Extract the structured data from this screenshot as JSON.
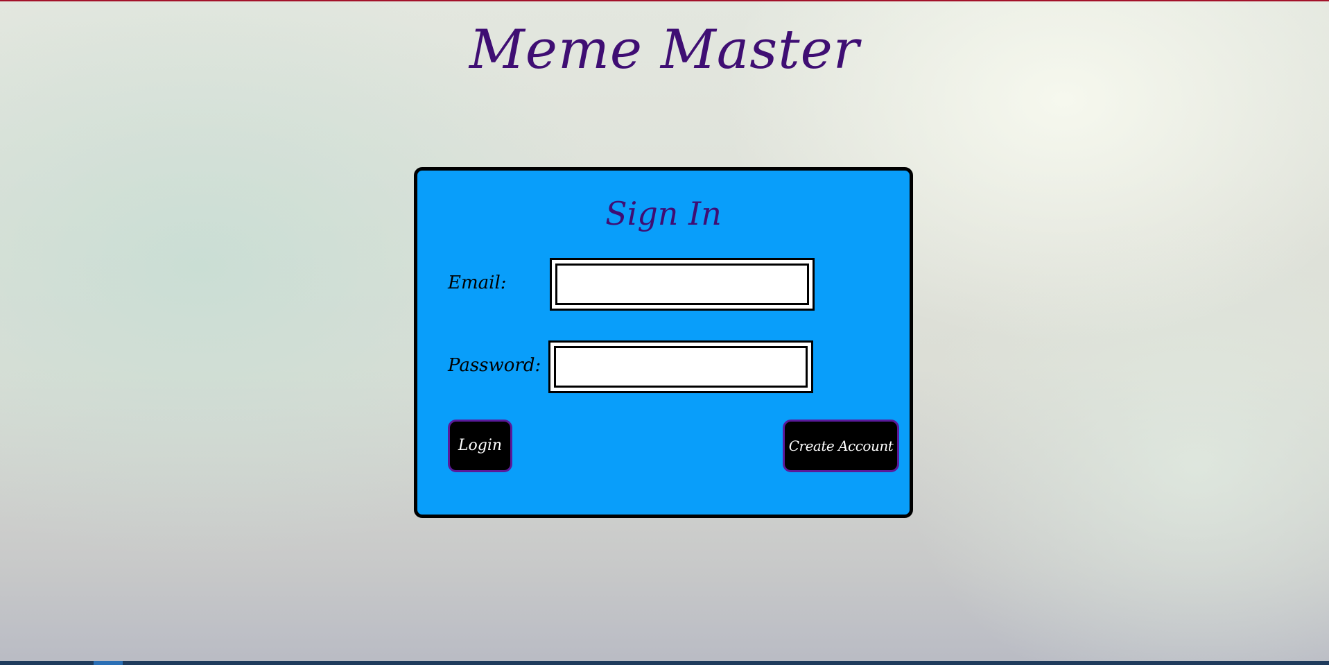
{
  "app": {
    "title": "Meme Master"
  },
  "signin": {
    "title": "Sign In",
    "email_label": "Email:",
    "email_value": "",
    "password_label": "Password:",
    "password_value": "",
    "login_label": "Login",
    "create_account_label": "Create Account"
  },
  "colors": {
    "title": "#3f0e73",
    "card_background": "#099efa",
    "button_background": "#000000",
    "button_border": "#5b1a9a",
    "top_accent": "#a3122a"
  }
}
